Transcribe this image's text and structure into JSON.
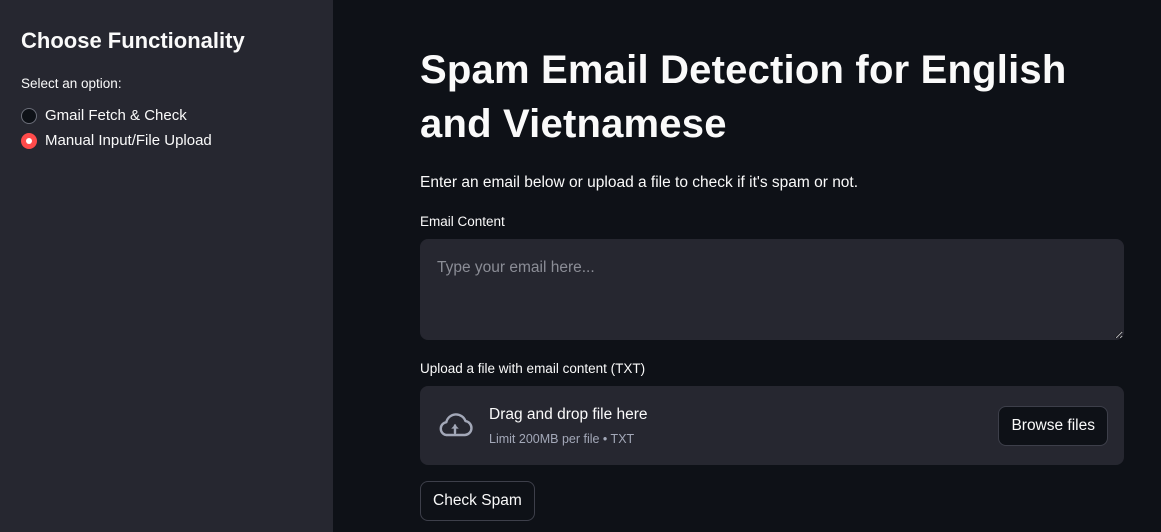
{
  "sidebar": {
    "title": "Choose Functionality",
    "radio_label": "Select an option:",
    "options": [
      {
        "label": "Gmail Fetch & Check",
        "selected": false
      },
      {
        "label": "Manual Input/File Upload",
        "selected": true
      }
    ]
  },
  "main": {
    "title": "Spam Email Detection for English and Vietnamese",
    "intro": "Enter an email below or upload a file to check if it's spam or not.",
    "email_field": {
      "label": "Email Content",
      "value": "",
      "placeholder": "Type your email here..."
    },
    "upload": {
      "label": "Upload a file with email content (TXT)",
      "drop_text": "Drag and drop file here",
      "limit_text": "Limit 200MB per file • TXT",
      "browse_label": "Browse files",
      "icon": "cloud-upload-icon"
    },
    "check_button": "Check Spam"
  },
  "colors": {
    "background": "#0e1117",
    "sidebar": "#262730",
    "accent": "#ff4b4b",
    "text": "#fafafa"
  }
}
